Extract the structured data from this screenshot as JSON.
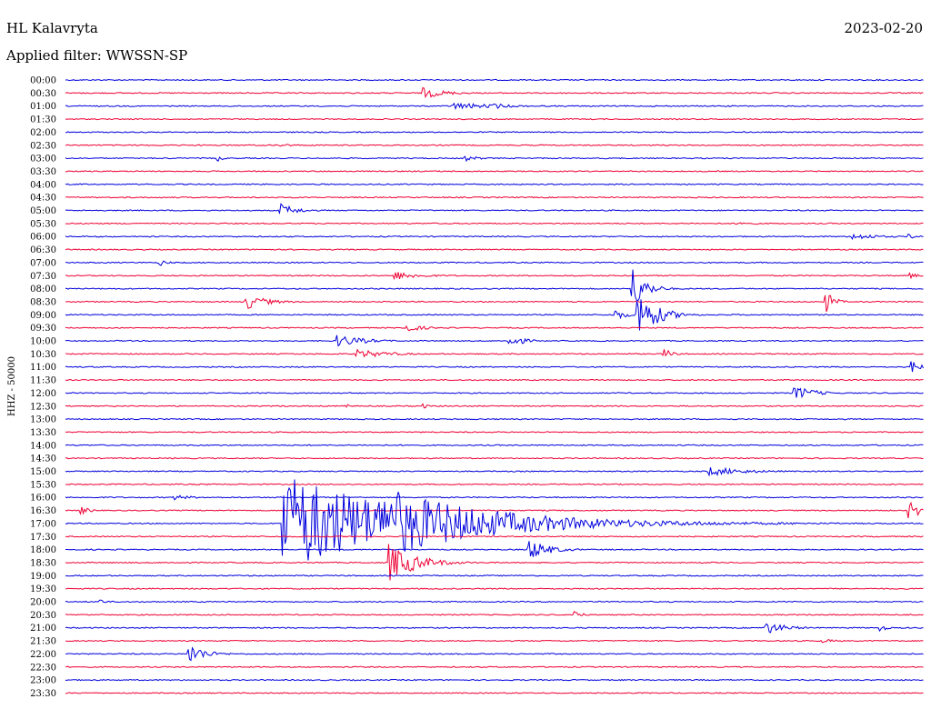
{
  "header": {
    "station": "HL Kalavryta",
    "date": "2023-02-20",
    "filter": "Applied filter: WWSSN-SP"
  },
  "chart_data": {
    "type": "line",
    "title": "HL Kalavryta",
    "subtitle": "Applied filter: WWSSN-SP",
    "date": "2023-02-20",
    "ylabel": "HHZ - 50000",
    "row_labels": [
      "00:00",
      "00:30",
      "01:00",
      "01:30",
      "02:00",
      "02:30",
      "03:00",
      "03:30",
      "04:00",
      "04:30",
      "05:00",
      "05:30",
      "06:00",
      "06:30",
      "07:00",
      "07:30",
      "08:00",
      "08:30",
      "09:00",
      "09:30",
      "10:00",
      "10:30",
      "11:00",
      "11:30",
      "12:00",
      "12:30",
      "13:00",
      "13:30",
      "14:00",
      "14:30",
      "15:00",
      "15:30",
      "16:00",
      "16:30",
      "17:00",
      "17:30",
      "18:00",
      "18:30",
      "19:00",
      "19:30",
      "20:00",
      "20:30",
      "21:00",
      "21:30",
      "22:00",
      "22:30",
      "23:00",
      "23:30"
    ],
    "row_minutes": 30,
    "colors": {
      "even_rows": "#0000dd",
      "odd_rows": "#ee0033"
    },
    "events": [
      {
        "row": "00:30",
        "minute": 12.5,
        "amplitude": 6,
        "duration": 1.8
      },
      {
        "row": "01:00",
        "minute": 13.5,
        "amplitude": 4,
        "duration": 3.5
      },
      {
        "row": "01:00",
        "minute": 15.0,
        "amplitude": 3,
        "duration": 1.5
      },
      {
        "row": "02:30",
        "minute": 7.5,
        "amplitude": 2,
        "duration": 1.0
      },
      {
        "row": "03:00",
        "minute": 5.3,
        "amplitude": 5,
        "duration": 0.3
      },
      {
        "row": "03:00",
        "minute": 14.0,
        "amplitude": 3,
        "duration": 1.2
      },
      {
        "row": "05:00",
        "minute": 7.5,
        "amplitude": 8,
        "duration": 1.2
      },
      {
        "row": "05:30",
        "minute": 23.5,
        "amplitude": 2,
        "duration": 1.5
      },
      {
        "row": "06:00",
        "minute": 27.5,
        "amplitude": 4,
        "duration": 2.0
      },
      {
        "row": "06:00",
        "minute": 29.5,
        "amplitude": 3,
        "duration": 0.8
      },
      {
        "row": "07:00",
        "minute": 3.3,
        "amplitude": 4,
        "duration": 0.6
      },
      {
        "row": "07:30",
        "minute": 11.5,
        "amplitude": 5,
        "duration": 2.0
      },
      {
        "row": "07:30",
        "minute": 29.5,
        "amplitude": 4,
        "duration": 0.6
      },
      {
        "row": "08:00",
        "minute": 19.8,
        "amplitude": 25,
        "duration": 1.0
      },
      {
        "row": "08:30",
        "minute": 6.3,
        "amplitude": 9,
        "duration": 1.5
      },
      {
        "row": "08:30",
        "minute": 26.6,
        "amplitude": 12,
        "duration": 0.6
      },
      {
        "row": "09:00",
        "minute": 19.2,
        "amplitude": 7,
        "duration": 0.8
      },
      {
        "row": "09:00",
        "minute": 20.0,
        "amplitude": 28,
        "duration": 1.4
      },
      {
        "row": "09:30",
        "minute": 11.8,
        "amplitude": 5,
        "duration": 1.5
      },
      {
        "row": "10:00",
        "minute": 9.5,
        "amplitude": 7,
        "duration": 2.0
      },
      {
        "row": "10:00",
        "minute": 15.5,
        "amplitude": 8,
        "duration": 1.0
      },
      {
        "row": "10:30",
        "minute": 10.2,
        "amplitude": 5,
        "duration": 2.5
      },
      {
        "row": "10:30",
        "minute": 20.9,
        "amplitude": 7,
        "duration": 0.6
      },
      {
        "row": "11:00",
        "minute": 29.6,
        "amplitude": 8,
        "duration": 0.6
      },
      {
        "row": "12:00",
        "minute": 25.5,
        "amplitude": 8,
        "duration": 1.5
      },
      {
        "row": "12:30",
        "minute": 9.8,
        "amplitude": 3,
        "duration": 0.4
      },
      {
        "row": "12:30",
        "minute": 12.5,
        "amplitude": 3,
        "duration": 0.4
      },
      {
        "row": "15:00",
        "minute": 22.5,
        "amplitude": 5,
        "duration": 3.0
      },
      {
        "row": "16:00",
        "minute": 3.8,
        "amplitude": 3,
        "duration": 1.5
      },
      {
        "row": "16:30",
        "minute": 0.5,
        "amplitude": 5,
        "duration": 0.8
      },
      {
        "row": "16:30",
        "minute": 29.5,
        "amplitude": 9,
        "duration": 1.5
      },
      {
        "row": "17:00",
        "minute": 7.6,
        "amplitude": 55,
        "duration": 10.0
      },
      {
        "row": "17:00",
        "minute": 11.2,
        "amplitude": 40,
        "duration": 8.0
      },
      {
        "row": "18:00",
        "minute": 16.2,
        "amplitude": 12,
        "duration": 1.5
      },
      {
        "row": "18:30",
        "minute": 11.3,
        "amplitude": 22,
        "duration": 2.0
      },
      {
        "row": "20:00",
        "minute": 1.2,
        "amplitude": 4,
        "duration": 0.4
      },
      {
        "row": "20:30",
        "minute": 17.8,
        "amplitude": 6,
        "duration": 0.5
      },
      {
        "row": "21:00",
        "minute": 24.5,
        "amplitude": 7,
        "duration": 1.5
      },
      {
        "row": "21:00",
        "minute": 28.5,
        "amplitude": 4,
        "duration": 0.5
      },
      {
        "row": "21:30",
        "minute": 26.5,
        "amplitude": 2,
        "duration": 1.5
      },
      {
        "row": "22:00",
        "minute": 4.3,
        "amplitude": 12,
        "duration": 1.2
      }
    ]
  }
}
